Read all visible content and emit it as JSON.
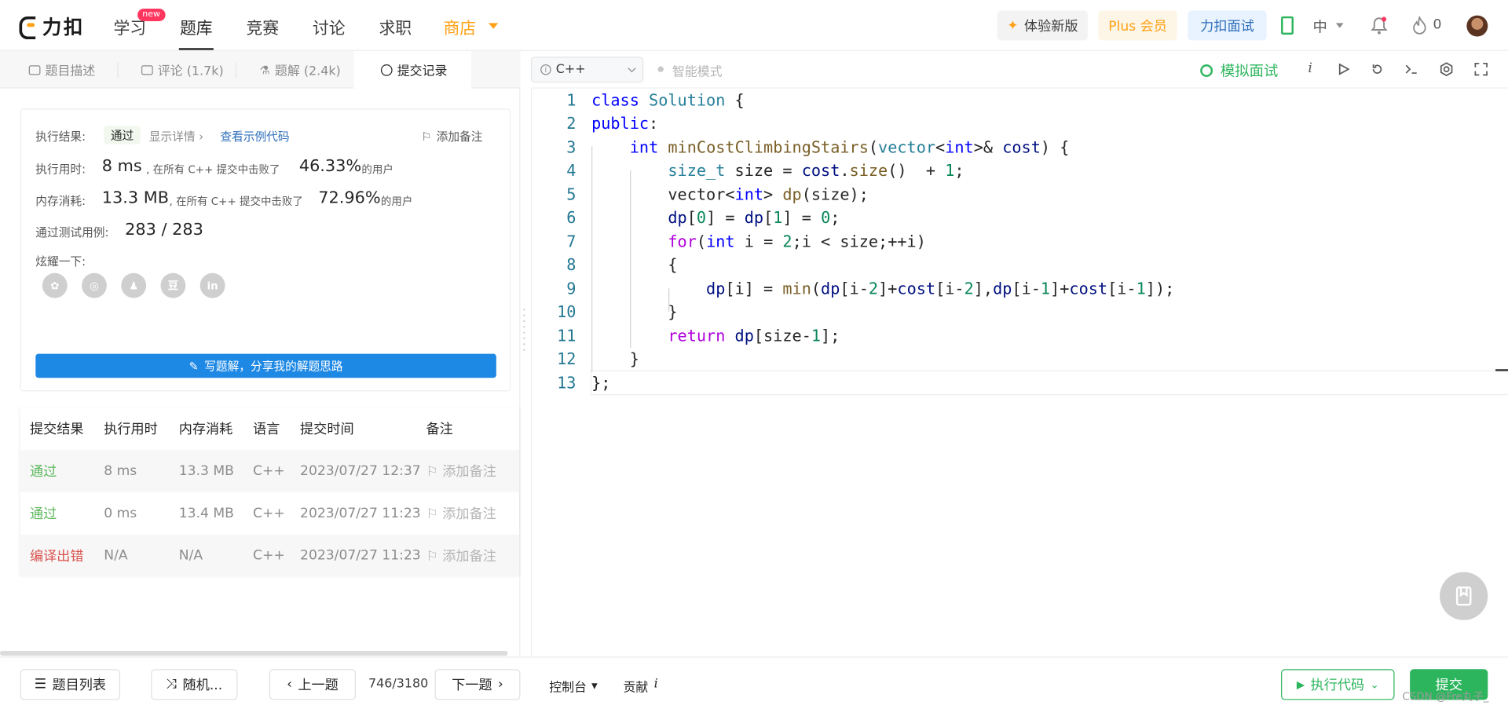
{
  "topnav": {
    "logo_text": "力扣",
    "items": [
      {
        "label": "学习"
      },
      {
        "label": "题库"
      },
      {
        "label": "竞赛"
      },
      {
        "label": "讨论"
      },
      {
        "label": "求职"
      },
      {
        "label": "商店"
      }
    ],
    "new_badge": "new",
    "try_new": "体验新版",
    "plus": "Plus 会员",
    "interview": "力扣面试",
    "lang": "中",
    "points": "0"
  },
  "tabs": [
    {
      "label": "题目描述"
    },
    {
      "label": "评论 (1.7k)"
    },
    {
      "label": "题解 (2.4k)"
    },
    {
      "label": "提交记录"
    }
  ],
  "editor_header": {
    "language": "C++",
    "smart_mode": "智能模式",
    "mock_interview": "模拟面试"
  },
  "result": {
    "exec_result_label": "执行结果:",
    "status": "通过",
    "show_detail": "显示详情 ›",
    "view_sample": "查看示例代码",
    "add_note": "添加备注",
    "time_label": "执行用时:",
    "time_value": "8 ms",
    "time_text": ", 在所有 C++ 提交中击败了",
    "time_pct": "46.33%",
    "time_suffix": "的用户",
    "mem_label": "内存消耗:",
    "mem_value": "13.3 MB",
    "mem_text": ", 在所有 C++ 提交中击败了",
    "mem_pct": "72.96%",
    "mem_suffix": "的用户",
    "cases_label": "通过测试用例:",
    "cases_value": "283 / 283",
    "share_label": "炫耀一下:",
    "share_icons": [
      {
        "name": "wechat-icon",
        "glyph": "✿"
      },
      {
        "name": "weibo-icon",
        "glyph": "◎"
      },
      {
        "name": "qq-icon",
        "glyph": "♟"
      },
      {
        "name": "douban-icon",
        "glyph": "豆"
      },
      {
        "name": "linkedin-icon",
        "glyph": "in"
      }
    ],
    "write_solution": "写题解，分享我的解题思路"
  },
  "submissions": {
    "headers": [
      "提交结果",
      "执行用时",
      "内存消耗",
      "语言",
      "提交时间",
      "备注"
    ],
    "rows": [
      {
        "status": "通过",
        "time": "8 ms",
        "mem": "13.3 MB",
        "lang": "C++",
        "date": "2023/07/27 12:37",
        "note": "添加备注"
      },
      {
        "status": "通过",
        "time": "0 ms",
        "mem": "13.4 MB",
        "lang": "C++",
        "date": "2023/07/27 11:23",
        "note": "添加备注"
      },
      {
        "status": "编译出错",
        "time": "N/A",
        "mem": "N/A",
        "lang": "C++",
        "date": "2023/07/27 11:23",
        "note": "添加备注"
      }
    ]
  },
  "code": {
    "line_numbers": [
      "1",
      "2",
      "3",
      "4",
      "5",
      "6",
      "7",
      "8",
      "9",
      "10",
      "11",
      "12",
      "13"
    ]
  },
  "bottombar": {
    "problem_list": "题目列表",
    "random": "随机...",
    "prev": "上一题",
    "progress": "746/3180",
    "next": "下一题",
    "console": "控制台",
    "contribute": "贡献",
    "run": "执行代码",
    "submit": "提交",
    "watermark": "CSDN @Fre丸子_"
  }
}
